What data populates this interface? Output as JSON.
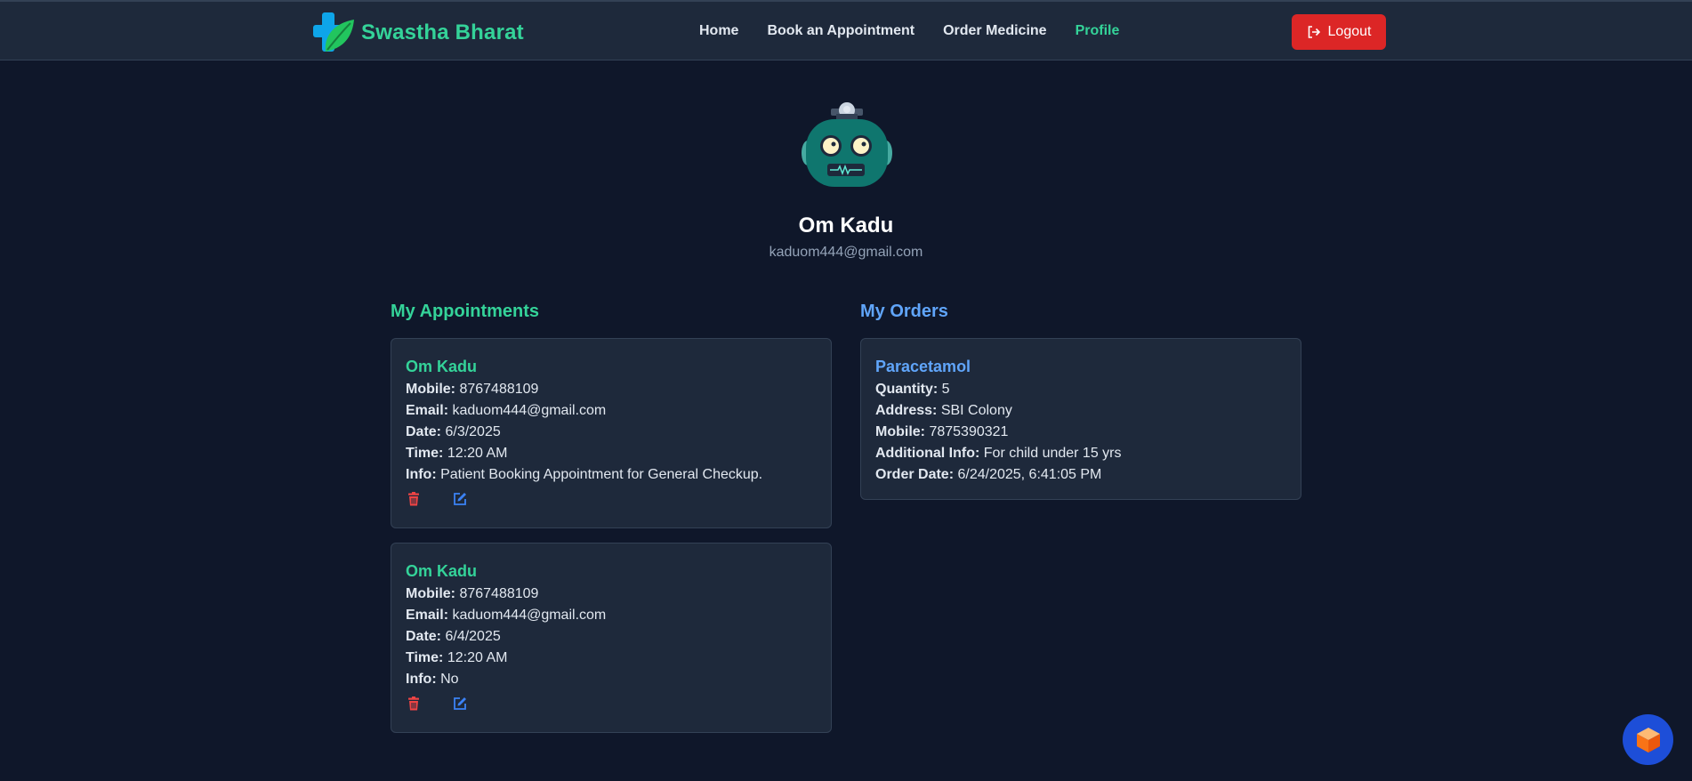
{
  "brand": {
    "name": "Swastha Bharat",
    "logo_icon": "cross-leaf-logo"
  },
  "nav": {
    "links": [
      {
        "label": "Home",
        "active": false
      },
      {
        "label": "Book an Appointment",
        "active": false
      },
      {
        "label": "Order Medicine",
        "active": false
      },
      {
        "label": "Profile",
        "active": true
      }
    ],
    "logout_label": "Logout",
    "logout_icon": "logout-icon"
  },
  "profile": {
    "avatar_icon": "robot-avatar",
    "name": "Om Kadu",
    "email": "kaduom444@gmail.com"
  },
  "appointments": {
    "title": "My Appointments",
    "labels": {
      "mobile": "Mobile:",
      "email": "Email:",
      "date": "Date:",
      "time": "Time:",
      "info": "Info:"
    },
    "items": [
      {
        "name": "Om Kadu",
        "mobile": "8767488109",
        "email": "kaduom444@gmail.com",
        "date": "6/3/2025",
        "time": "12:20 AM",
        "info": "Patient Booking Appointment for General Checkup."
      },
      {
        "name": "Om Kadu",
        "mobile": "8767488109",
        "email": "kaduom444@gmail.com",
        "date": "6/4/2025",
        "time": "12:20 AM",
        "info": "No"
      }
    ]
  },
  "orders": {
    "title": "My Orders",
    "labels": {
      "quantity": "Quantity:",
      "address": "Address:",
      "mobile": "Mobile:",
      "additional": "Additional Info:",
      "order_date": "Order Date:"
    },
    "items": [
      {
        "medicine": "Paracetamol",
        "quantity": "5",
        "address": "SBI Colony",
        "mobile": "7875390321",
        "additional": "For child under 15 yrs",
        "order_date": "6/24/2025, 6:41:05 PM"
      }
    ]
  },
  "colors": {
    "background": "#0f172a",
    "card": "#1e293b",
    "accent_green": "#34d399",
    "accent_blue": "#60a5fa",
    "danger": "#dc2626"
  },
  "fab_icon": "cube-icon"
}
